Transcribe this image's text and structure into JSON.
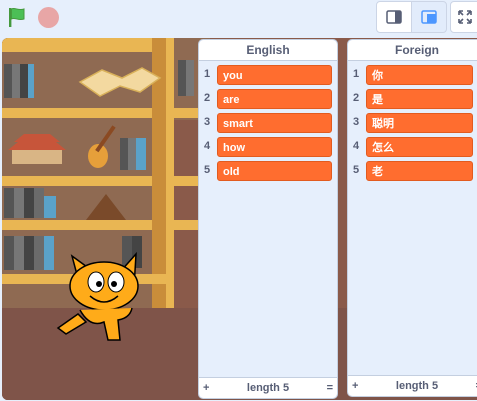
{
  "toolbar": {
    "green_flag_icon": "green-flag-icon",
    "stop_icon": "stop-sign-icon",
    "small_stage_icon": "small-stage-icon",
    "large_stage_icon": "large-stage-icon",
    "fullscreen_icon": "fullscreen-icon"
  },
  "lists": [
    {
      "title": "English",
      "items": [
        "you",
        "are",
        "smart",
        "how",
        "old"
      ],
      "indices": [
        "1",
        "2",
        "3",
        "4",
        "5"
      ],
      "footer": {
        "add": "+",
        "length": "length 5",
        "resize": "="
      }
    },
    {
      "title": "Foreign",
      "items": [
        "你",
        "是",
        "聪明",
        "怎么",
        "老"
      ],
      "indices": [
        "1",
        "2",
        "3",
        "4",
        "5"
      ],
      "footer": {
        "add": "+",
        "length": "length 5",
        "resize": "="
      }
    }
  ],
  "colors": {
    "list_item": "#ff6d2f",
    "background": "#e6effc",
    "flag": "#4cbf56",
    "stop": "#e8a6a6"
  }
}
